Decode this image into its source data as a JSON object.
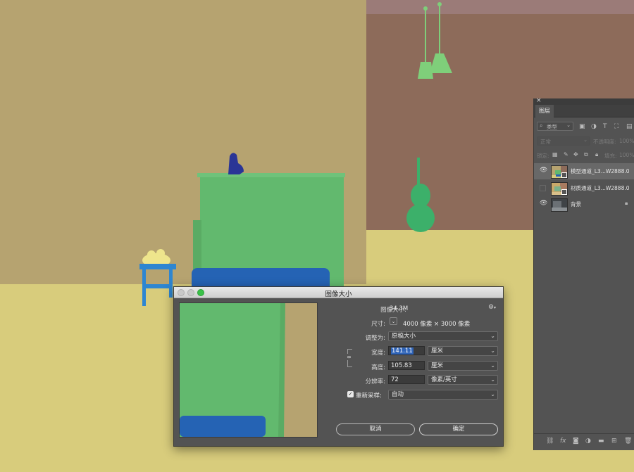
{
  "dialog": {
    "title": "图像大小",
    "image_size_label": "图像大小:",
    "image_size_value": "34.3M",
    "dimensions_label": "尺寸:",
    "dimensions_value": "4000 像素  ×  3000 像素",
    "fit_to_label": "调整为:",
    "fit_to_value": "原稿大小",
    "width_label": "宽度:",
    "width_value": "141.11",
    "width_unit": "厘米",
    "height_label": "高度:",
    "height_value": "105.83",
    "height_unit": "厘米",
    "resolution_label": "分辨率:",
    "resolution_value": "72",
    "resolution_unit": "像素/英寸",
    "resample_label": "重新采样:",
    "resample_value": "自动",
    "cancel_label": "取消",
    "ok_label": "确定",
    "window_controls": [
      "close-icon",
      "minimize-icon",
      "zoom-icon"
    ]
  },
  "layers_panel": {
    "close_glyph": "×",
    "tab_label": "图层",
    "filter_placeholder": "类型",
    "blend_mode": "正常",
    "opacity_label": "不透明度:",
    "opacity_value": "100%",
    "lock_label": "锁定:",
    "fill_label": "填充:",
    "fill_value": "100%",
    "layers": [
      {
        "name": "模型通道_L3...W2888.0",
        "visible": true
      },
      {
        "name": "材质通道_L3...W2888.0",
        "visible": false
      },
      {
        "name": "背景",
        "visible": true,
        "locked": true
      }
    ],
    "bottom_icons": [
      "link-icon",
      "fx-icon",
      "mask-icon",
      "adjustment-icon",
      "folder-icon",
      "new-layer-icon",
      "trash-icon"
    ]
  },
  "colors": {
    "wall_left": "#b6a370",
    "wall_right": "#8d6b5a",
    "floor": "#d8cc7c",
    "cabinet": "#62b96e",
    "sofa": "#2563b4",
    "violin": "#3cb06a",
    "dialog_bg": "#535353",
    "selection": "#2f64b8",
    "zoom_green": "#3ac148"
  }
}
